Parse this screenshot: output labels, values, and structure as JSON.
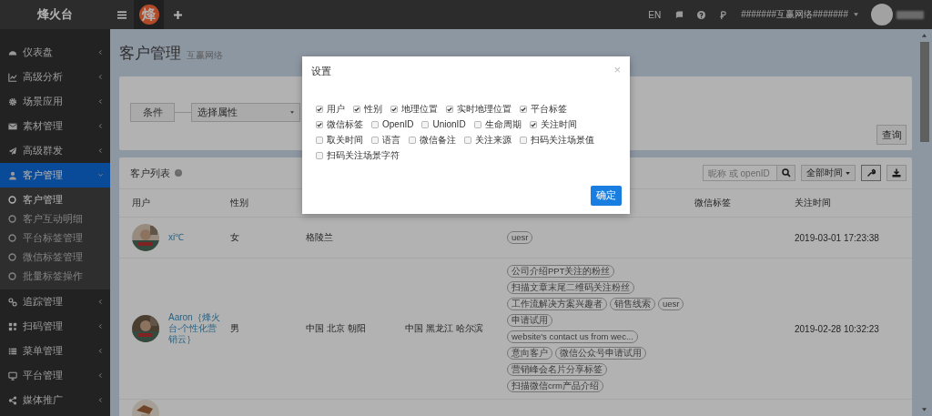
{
  "topbar": {
    "brand": "烽火台",
    "logo_char": "烽",
    "language": "EN",
    "account": "#######互赢网络#######"
  },
  "sidebar": {
    "items": [
      {
        "label": "仪表盘",
        "selected": false,
        "expanded": false
      },
      {
        "label": "高级分析",
        "selected": false,
        "expanded": false
      },
      {
        "label": "场景应用",
        "selected": false,
        "expanded": false
      },
      {
        "label": "素材管理",
        "selected": false,
        "expanded": false
      },
      {
        "label": "高级群发",
        "selected": false,
        "expanded": false
      },
      {
        "label": "客户管理",
        "selected": true,
        "expanded": true,
        "children": [
          {
            "label": "客户管理",
            "selected": true
          },
          {
            "label": "客户互动明细",
            "selected": false
          },
          {
            "label": "平台标签管理",
            "selected": false
          },
          {
            "label": "微信标签管理",
            "selected": false
          },
          {
            "label": "批量标签操作",
            "selected": false
          }
        ]
      },
      {
        "label": "追踪管理",
        "selected": false,
        "expanded": false
      },
      {
        "label": "扫码管理",
        "selected": false,
        "expanded": false
      },
      {
        "label": "菜单管理",
        "selected": false,
        "expanded": false
      },
      {
        "label": "平台管理",
        "selected": false,
        "expanded": false
      },
      {
        "label": "媒体推广",
        "selected": false,
        "expanded": false
      }
    ]
  },
  "page": {
    "title": "客户管理",
    "subtitle": "互赢网络"
  },
  "filter": {
    "condition": "条件",
    "attribute_select": "选择属性",
    "query_button": "查询"
  },
  "customer_list": {
    "title": "客户列表",
    "search": {
      "placeholder": "昵称 或 openID"
    },
    "time_filter": "全部时间"
  },
  "table": {
    "headers": {
      "column_1": "用户",
      "column_2": "性别",
      "column_6": "微信标签",
      "column_7": "关注时间"
    },
    "rows": [
      {
        "user": "xi℃",
        "gender": "女",
        "column_3": "格陵兰",
        "column_5": [
          "uesr"
        ],
        "follow_time": "2019-03-01 17:23:38"
      },
      {
        "user": "Aaron｛烽火台-个性化营销云｝",
        "gender": "男",
        "column_3": "中国 北京 朝阳",
        "column_4": "中国 黑龙江 哈尔滨",
        "column_5": [
          "公司介绍PPT关注的粉丝",
          "扫描文章末尾二维码关注粉丝",
          "工作流解决方案兴趣者",
          "销售线索",
          "uesr",
          "申请试用",
          "website's contact us from wec...",
          "意向客户",
          "微信公众号申请试用",
          "营销峰会名片分享标签",
          "扫描微信crm产品介绍"
        ],
        "follow_time": "2019-02-28 10:32:23"
      }
    ]
  },
  "modal": {
    "title": "设置",
    "close": "×",
    "options": [
      {
        "label": "用户",
        "checked": true
      },
      {
        "label": "性别",
        "checked": true
      },
      {
        "label": "地理位置",
        "checked": true
      },
      {
        "label": "实时地理位置",
        "checked": true
      },
      {
        "label": "平台标签",
        "checked": true
      },
      {
        "label": "微信标签",
        "checked": true
      },
      {
        "label": "OpenID",
        "checked": false
      },
      {
        "label": "UnionID",
        "checked": false
      },
      {
        "label": "生命周期",
        "checked": false
      },
      {
        "label": "关注时间",
        "checked": true
      },
      {
        "label": "取关时间",
        "checked": false
      },
      {
        "label": "语言",
        "checked": false
      },
      {
        "label": "微信备注",
        "checked": false
      },
      {
        "label": "关注来源",
        "checked": false
      },
      {
        "label": "扫码关注场景值",
        "checked": false
      },
      {
        "label": "扫码关注场景字符",
        "checked": false
      }
    ],
    "confirm": "确定"
  }
}
